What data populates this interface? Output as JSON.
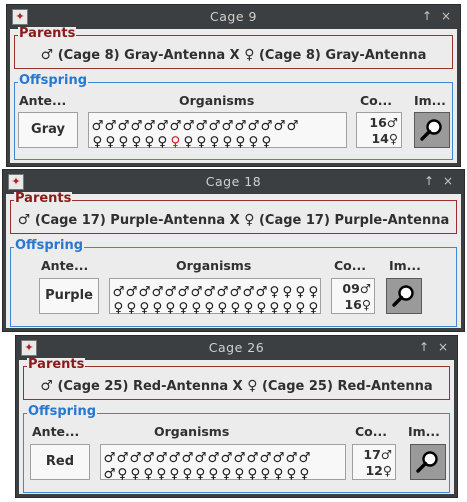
{
  "windows": [
    {
      "title": "Cage 9",
      "parents_label": "Parents",
      "parent_text": "(Cage 8) Gray-Antenna X",
      "parent_text2": "(Cage 8) Gray-Antenna",
      "offspring_label": "Offspring",
      "col_antenna": "Ante...",
      "col_organisms": "Organisms",
      "col_count": "Co...",
      "col_image": "Im...",
      "antenna_value": "Gray",
      "male_count": "16",
      "female_count": "14",
      "rows": [
        [
          "♂",
          "♂",
          "♂",
          "♂",
          "♂",
          "♂",
          "♂",
          "♂",
          "♂",
          "♂",
          "♂",
          "♂",
          "♂",
          "♂",
          "♂",
          "♂"
        ],
        [
          "♀",
          "♀",
          "♀",
          "♀",
          "♀",
          "♀",
          "♀",
          "♀",
          "♀",
          "♀",
          "♀",
          "♀",
          "♀",
          "♀"
        ]
      ],
      "highlight_index": 6
    },
    {
      "title": "Cage 18",
      "parents_label": "Parents",
      "parent_text": "(Cage 17) Purple-Antenna X",
      "parent_text2": "(Cage 17) Purple-Antenna",
      "offspring_label": "Offspring",
      "col_antenna": "Ante...",
      "col_organisms": "Organisms",
      "col_count": "Co...",
      "col_image": "Im...",
      "antenna_value": "Purple",
      "male_count": "09",
      "female_count": "16",
      "rows": [
        [
          "♂",
          "♂",
          "♂",
          "♂",
          "♂",
          "♂",
          "♂",
          "♂",
          "♂",
          "♂",
          "♂",
          "♂",
          "♀",
          "♀",
          "♀",
          "♀"
        ],
        [
          "♀",
          "♀",
          "♀",
          "♀",
          "♀",
          "♀",
          "♀",
          "♀",
          "♀",
          "♀",
          "♀",
          "♀",
          "♀",
          "♀",
          "♀",
          "♀"
        ]
      ],
      "highlight_index": -1
    },
    {
      "title": "Cage 26",
      "parents_label": "Parents",
      "parent_text": "(Cage 25) Red-Antenna X",
      "parent_text2": "(Cage 25) Red-Antenna",
      "offspring_label": "Offspring",
      "col_antenna": "Ante...",
      "col_organisms": "Organisms",
      "col_count": "Co...",
      "col_image": "Im...",
      "antenna_value": "Red",
      "male_count": "17",
      "female_count": "12",
      "rows": [
        [
          "♂",
          "♂",
          "♂",
          "♂",
          "♂",
          "♂",
          "♂",
          "♂",
          "♂",
          "♂",
          "♂",
          "♂",
          "♂",
          "♂",
          "♂",
          "♂"
        ],
        [
          "♂",
          "♀",
          "♀",
          "♀",
          "♀",
          "♀",
          "♀",
          "♀",
          "♀",
          "♀",
          "♀",
          "♀",
          "♀",
          "♀",
          "♀",
          "♀"
        ]
      ],
      "highlight_index": -1
    }
  ],
  "symbols": {
    "male": "♂",
    "female": "♀"
  },
  "controls": {
    "pin": "↑",
    "close": "×"
  },
  "colors": {
    "parents_border": "#9a2f2f",
    "offspring_border": "#3d88d6",
    "titlebar": "#3c3f41",
    "panel": "#ececec"
  }
}
